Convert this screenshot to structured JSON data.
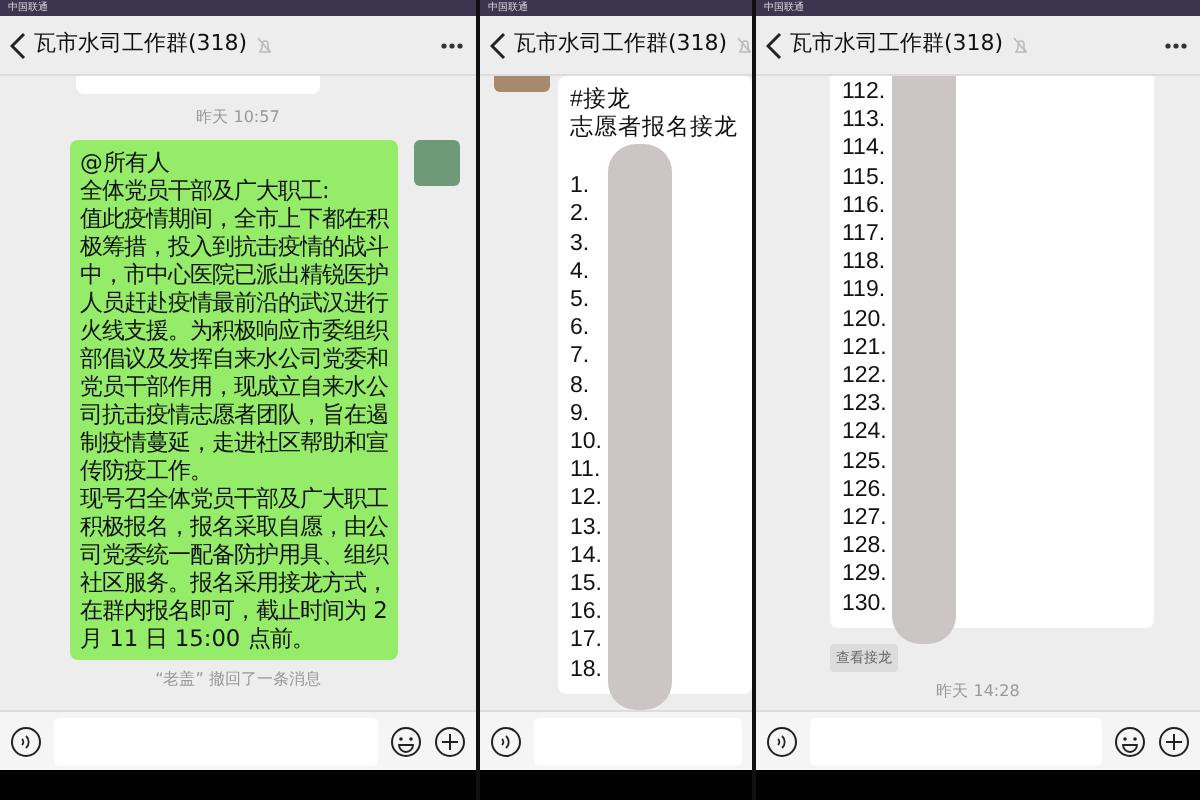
{
  "panels": [
    {
      "carrier": "中国联通",
      "title": "瓦市水司工作群(318)",
      "muted": true,
      "show_menu": true,
      "messages": [
        {
          "kind": "cut_bubble"
        },
        {
          "kind": "time",
          "text": "昨天 10:57"
        },
        {
          "kind": "self_text",
          "lines": [
            "@所有人",
            "全体党员干部及广大职工:",
            "值此疫情期间，全市上下都在积极筹措，投入到抗击疫情的战斗中，市中心医院已派出精锐医护人员赶赴疫情最前沿的武汉进行火线支援。为积极响应市委组织部倡议及发挥自来水公司党委和党员干部作用，现成立自来水公司抗击疫情志愿者团队，旨在遏制疫情蔓延，走进社区帮助和宣传防疫工作。",
            "现号召全体党员干部及广大职工积极报名，报名采取自愿，由公司党委统一配备防护用具、组织社区服务。报名采用接龙方式，在群内报名即可，截止时间为 2 月 11 日 15:00 点前。"
          ]
        },
        {
          "kind": "notice",
          "text": "“老盖” 撤回了一条消息"
        }
      ]
    },
    {
      "carrier": "中国联通",
      "title": "瓦市水司工作群(318)",
      "muted": true,
      "show_menu": false,
      "messages": [
        {
          "kind": "list",
          "top_cut": false,
          "redacted": true,
          "head": [
            "#接龙",
            "志愿者报名接龙"
          ],
          "items": [
            "1.",
            "2.",
            "3.",
            "4.",
            "5.",
            "6.",
            "7.",
            "8.",
            "9.",
            "10.",
            "11.",
            "12.",
            "13.",
            "14.",
            "15.",
            "16.",
            "17.",
            "18."
          ]
        }
      ]
    },
    {
      "carrier": "中国联通",
      "title": "瓦市水司工作群(318)",
      "muted": true,
      "show_menu": true,
      "messages": [
        {
          "kind": "list",
          "top_cut": true,
          "redacted": true,
          "items": [
            "112.",
            "113.",
            "114.",
            "115.",
            "116.",
            "117.",
            "118.",
            "119.",
            "120.",
            "121.",
            "122.",
            "123.",
            "124.",
            "125.",
            "126.",
            "127.",
            "128.",
            "129.",
            "130."
          ],
          "action": "查看接龙"
        },
        {
          "kind": "time",
          "text": "昨天 14:28"
        }
      ]
    }
  ]
}
